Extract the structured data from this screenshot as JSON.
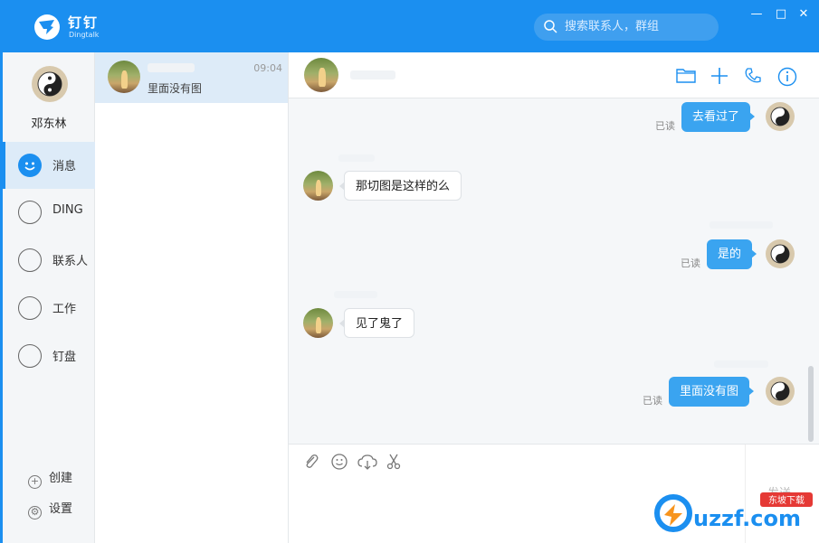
{
  "app": {
    "name": "钉钉",
    "subname": "Dingtalk",
    "search_placeholder": "搜索联系人，群组",
    "window_min": "—",
    "window_max": "□",
    "window_close": "✕"
  },
  "nav": {
    "user_name": "邓东林",
    "items": [
      {
        "label": "消息",
        "icon": "message-icon"
      },
      {
        "label": "DING",
        "icon": "ding-icon"
      },
      {
        "label": "联系人",
        "icon": "contacts-icon"
      },
      {
        "label": "工作",
        "icon": "compass-icon"
      },
      {
        "label": "钉盘",
        "icon": "cloud-drive-icon"
      }
    ],
    "create_label": "创建",
    "settings_label": "设置"
  },
  "conversation": {
    "time": "09:04",
    "preview": "里面没有图"
  },
  "messages": [
    {
      "text": "去看过了",
      "direction": "out",
      "status": "已读"
    },
    {
      "text": "那切图是这样的么",
      "direction": "in"
    },
    {
      "text": "是的",
      "direction": "out",
      "status": "已读"
    },
    {
      "text": "见了鬼了",
      "direction": "in"
    },
    {
      "text": "里面没有图",
      "direction": "out",
      "status": "已读"
    }
  ],
  "compose": {
    "send_label": "发送",
    "tools": [
      "attachment-icon",
      "emoji-icon",
      "cloud-upload-icon",
      "scissors-icon"
    ]
  },
  "watermark": {
    "brand": "uzzf.com",
    "tag": "东坡下载"
  },
  "colors": {
    "primary": "#1b8ff0",
    "bubble_out": "#3aa4f0",
    "nav_active": "#ddebf8"
  }
}
